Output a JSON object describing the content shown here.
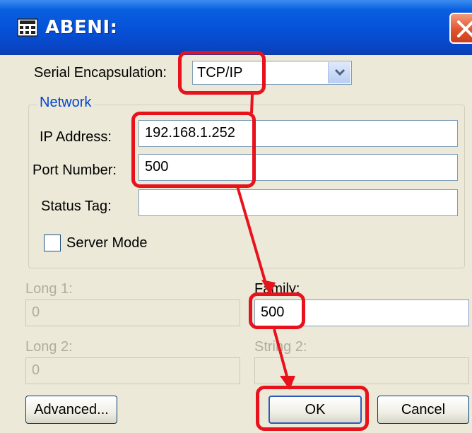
{
  "window": {
    "title": "ABENI:",
    "icon": "calculator-icon",
    "close_icon": "close-icon"
  },
  "serial": {
    "label": "Serial Encapsulation:",
    "selected": "TCP/IP",
    "dropdown_icon": "chevron-down-icon"
  },
  "network": {
    "group_label": "Network",
    "ip_label": "IP Address:",
    "ip_value": "192.168.1.252",
    "port_label": "Port Number:",
    "port_value": "500",
    "status_label": "Status Tag:",
    "status_value": "",
    "server_mode_label": "Server Mode",
    "server_mode_checked": false
  },
  "fields": {
    "long1_label": "Long 1:",
    "long1_value": "0",
    "family_label": "Family:",
    "family_value": "500",
    "long2_label": "Long 2:",
    "long2_value": "0",
    "string2_label": "String 2:",
    "string2_value": ""
  },
  "buttons": {
    "advanced": "Advanced...",
    "ok": "OK",
    "cancel": "Cancel"
  },
  "colors": {
    "titlebar": "#0551d8",
    "annotation": "#e8121d",
    "group_label": "#0046d5",
    "dialog_bg": "#ece9d8"
  }
}
